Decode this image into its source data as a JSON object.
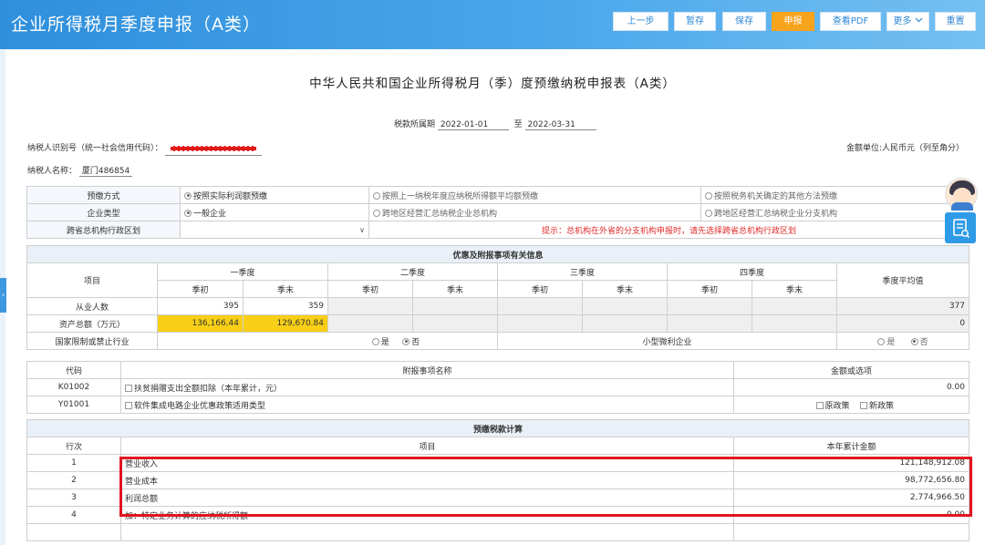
{
  "header": {
    "title": "企业所得税月季度申报（A类）",
    "buttons": {
      "prev": "上一步",
      "pause": "暂存",
      "save": "保存",
      "submit": "申报",
      "pdf": "查看PDF",
      "more": "更多",
      "reset": "重置"
    }
  },
  "colors": {
    "header": "#3a9be2",
    "accent": "#f7a31c",
    "highlight": "#f8cf16",
    "alert": "#e0141e"
  },
  "form": {
    "title": "中华人民共和国企业所得税月（季）度预缴纳税申报表（A类）",
    "period_label": "税款所属期",
    "period_start": "2022-01-01",
    "period_to": "至",
    "period_end": "2022-03-31",
    "taxpayer_id_label": "纳税人识别号（统一社会信用代码）：",
    "unit_label": "金额单位:人民币元（列至角分）",
    "taxpayer_name_label": "纳税人名称：",
    "taxpayer_name": "厦门486854"
  },
  "basic": {
    "prepay_label": "预缴方式",
    "prepay_opt1": "按照实际利润额预缴",
    "prepay_opt2": "按照上一纳税年度应纳税所得额平均额预缴",
    "prepay_opt3": "按照税务机关确定的其他方法预缴",
    "type_label": "企业类型",
    "type_opt1": "一般企业",
    "type_opt2": "跨地区经营汇总纳税企业总机构",
    "type_opt3": "跨地区经营汇总纳税企业分支机构",
    "region_label": "跨省总机构行政区划",
    "region_hint": "提示：总机构在外省的分支机构申报时，请先选择跨省总机构行政区划"
  },
  "incentive": {
    "section_title": "优惠及附报事项有关信息",
    "item_header": "项目",
    "q1": "一季度",
    "q2": "二季度",
    "q3": "三季度",
    "q4": "四季度",
    "avg": "季度平均值",
    "begin": "季初",
    "end": "季末",
    "employees_label": "从业人数",
    "employees_q1_begin": "395",
    "employees_q1_end": "359",
    "employees_avg": "377",
    "assets_label": "资产总额（万元）",
    "assets_q1_begin": "136,166.44",
    "assets_q1_end": "129,670.84",
    "assets_avg": "0",
    "restricted_label": "国家限制或禁止行业",
    "yes": "是",
    "no": "否",
    "small_label": "小型微利企业"
  },
  "attached": {
    "code_header": "代码",
    "name_header": "附报事项名称",
    "value_header": "金额或选项",
    "rows": [
      {
        "code": "K01002",
        "name": "扶贫捐赠支出全额扣除（本年累计，元）",
        "value": "0.00"
      },
      {
        "code": "Y01001",
        "name": "软件集成电路企业优惠政策适用类型",
        "opt_old": "原政策",
        "opt_new": "新政策"
      }
    ]
  },
  "calc": {
    "section_title": "预缴税款计算",
    "line_header": "行次",
    "item_header": "项目",
    "amount_header": "本年累计金额",
    "rows": [
      {
        "line": "1",
        "item": "营业收入",
        "amount": "121,148,912.08"
      },
      {
        "line": "2",
        "item": "营业成本",
        "amount": "98,772,656.80"
      },
      {
        "line": "3",
        "item": "利润总额",
        "amount": "2,774,966.50"
      },
      {
        "line": "4",
        "item": "加：特定业务计算的应纳税所得额",
        "amount": "0.00"
      }
    ]
  },
  "icons": {
    "avatar": "customer-service-avatar",
    "side": "form-list-icon",
    "more": "chevron-down-icon"
  }
}
